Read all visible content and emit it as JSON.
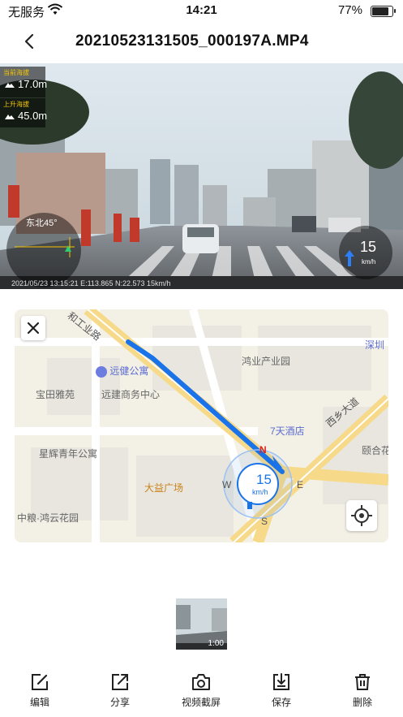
{
  "status_bar": {
    "carrier": "无服务",
    "time": "14:21",
    "battery": "77%",
    "battery_level": 0.77
  },
  "navbar": {
    "title": "20210523131505_000197A.MP4",
    "back_icon": "chevron-left-icon"
  },
  "video": {
    "altitude_label": "当前海拔",
    "altitude_value": "17.0m",
    "climb_label": "上升海拔",
    "climb_value": "45.0m",
    "compass_direction": "东北45°",
    "speed_value": "15",
    "speed_unit": "km/h",
    "timestamp_overlay": "2021/05/23 13:15:21 E:113.865 N:22.573 15km/h"
  },
  "map": {
    "close_icon": "close-icon",
    "locate_icon": "crosshair-icon",
    "road_labels": [
      "和工业路",
      "西乡大道"
    ],
    "pois": [
      "远健公寓",
      "鸿业产业园",
      "宝田雅苑",
      "远建商务中心",
      "7天酒店",
      "星辉青年公寓",
      "大益广场",
      "中粮·鸿云花园",
      "颐合花",
      "深圳"
    ],
    "compass": {
      "n": "N",
      "e": "E",
      "s": "S",
      "w": "W"
    },
    "speed_value": "15",
    "speed_unit": "km/h"
  },
  "thumbnail": {
    "duration": "1:00"
  },
  "toolbar": {
    "items": [
      {
        "label": "编辑",
        "icon": "edit-icon"
      },
      {
        "label": "分享",
        "icon": "share-icon"
      },
      {
        "label": "视频截屏",
        "icon": "camera-icon"
      },
      {
        "label": "保存",
        "icon": "save-icon"
      },
      {
        "label": "删除",
        "icon": "trash-icon"
      }
    ]
  },
  "colors": {
    "route_blue": "#1a73e8",
    "compass_red": "#e02020",
    "hud_yellow": "#f2c400"
  }
}
